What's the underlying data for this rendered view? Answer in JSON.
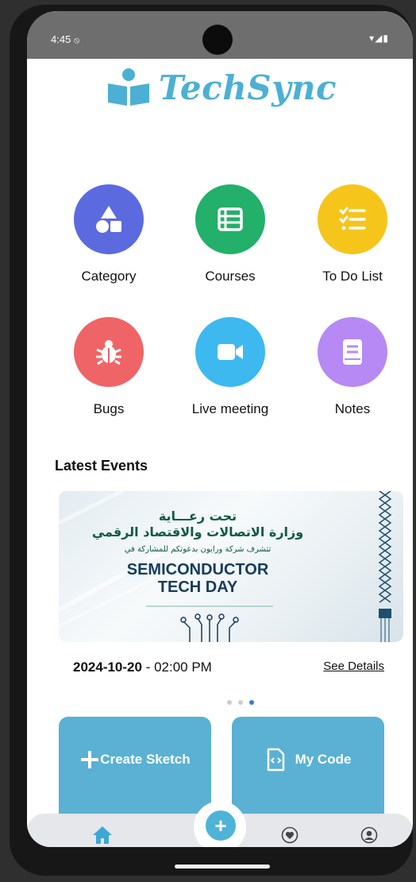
{
  "status": {
    "time": "4:45",
    "icons": "▾◢▮"
  },
  "app": {
    "name": "TechSync"
  },
  "grid": [
    {
      "label": "Category",
      "color": "#5c6ae0",
      "icon": "shapes-icon"
    },
    {
      "label": "Courses",
      "color": "#22b06a",
      "icon": "list-box-icon"
    },
    {
      "label": "To Do List",
      "color": "#f6c51b",
      "icon": "checklist-icon"
    },
    {
      "label": "Bugs",
      "color": "#ef6466",
      "icon": "bug-icon"
    },
    {
      "label": "Live meeting",
      "color": "#3db9ef",
      "icon": "video-camera-icon"
    },
    {
      "label": "Notes",
      "color": "#b689f4",
      "icon": "note-icon"
    }
  ],
  "events": {
    "title": "Latest Events",
    "banner": {
      "ar_line1": "تحت رعـــاية",
      "ar_line2": "وزارة الاتصالات والاقتصاد الرقمي",
      "ar_line3": "تتشرف شركة ورايون بدعوتكم للمشاركة في",
      "title_line1": "SEMICONDUCTOR",
      "title_line2": "TECH DAY"
    },
    "date": "2024-10-20",
    "time": " - 02:00 PM",
    "see_details": "See Details",
    "page_count": 3,
    "active_page": 3
  },
  "actions": {
    "create_sketch": "Create Sketch",
    "my_code": "My Code"
  },
  "nav": {
    "items": [
      "home-icon",
      "heart-icon",
      "profile-icon"
    ],
    "fab": "+"
  }
}
